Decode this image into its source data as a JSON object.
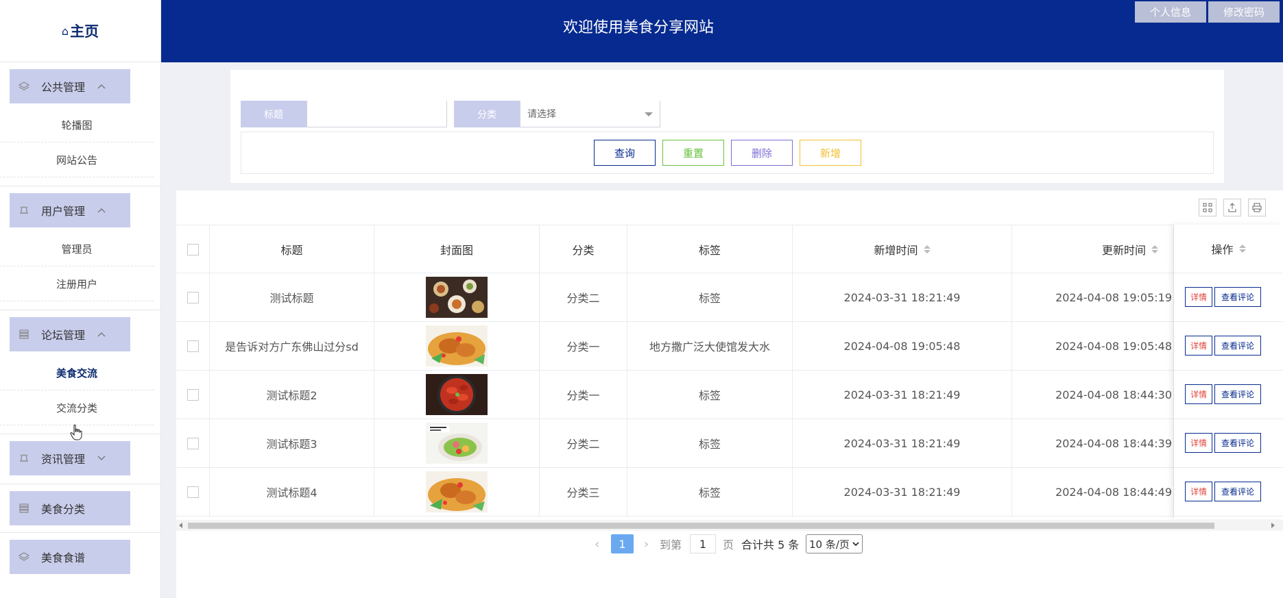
{
  "sidebar": {
    "home_label": "主页",
    "groups": [
      {
        "label": "公共管理",
        "items": [
          "轮播图",
          "网站公告"
        ]
      },
      {
        "label": "用户管理",
        "items": [
          "管理员",
          "注册用户"
        ]
      },
      {
        "label": "论坛管理",
        "items": [
          "美食交流",
          "交流分类"
        ]
      },
      {
        "label": "资讯管理",
        "items": []
      },
      {
        "label": "美食分类",
        "items": []
      },
      {
        "label": "美食食谱",
        "items": []
      }
    ],
    "active_item": "美食交流"
  },
  "header": {
    "title": "欢迎使用美食分享网站",
    "profile_button": "个人信息",
    "password_button": "修改密码"
  },
  "search": {
    "title_label": "标题",
    "title_value": "",
    "category_label": "分类",
    "category_placeholder": "请选择",
    "buttons": {
      "query": "查询",
      "reset": "重置",
      "delete": "删除",
      "add": "新增"
    }
  },
  "colors": {
    "primary": "#062a8f",
    "accent_light": "#c9cdec",
    "reset_green": "#67c23a",
    "delete_purple": "#7b6fd6",
    "add_yellow": "#f0c030",
    "detail_red": "#e0443b",
    "page_active": "#6aa9f0"
  },
  "table": {
    "columns": [
      "标题",
      "封面图",
      "分类",
      "标签",
      "新增时间",
      "更新时间",
      "操作"
    ],
    "rows": [
      {
        "title": "测试标题",
        "category": "分类二",
        "tag": "标签",
        "created": "2024-03-31 18:21:49",
        "updated": "2024-04-08 19:05:19"
      },
      {
        "title": "是告诉对方广东佛山过分sd",
        "category": "分类一",
        "tag": "地方撒广泛大使馆发大水",
        "created": "2024-04-08 19:05:48",
        "updated": "2024-04-08 19:05:48"
      },
      {
        "title": "测试标题2",
        "category": "分类一",
        "tag": "标签",
        "created": "2024-03-31 18:21:49",
        "updated": "2024-04-08 18:44:30"
      },
      {
        "title": "测试标题3",
        "category": "分类二",
        "tag": "标签",
        "created": "2024-03-31 18:21:49",
        "updated": "2024-04-08 18:44:39"
      },
      {
        "title": "测试标题4",
        "category": "分类三",
        "tag": "标签",
        "created": "2024-03-31 18:21:49",
        "updated": "2024-04-08 18:44:49"
      }
    ],
    "action_detail": "详情",
    "action_comments": "查看评论"
  },
  "pager": {
    "current_page": "1",
    "goto_label": "到第",
    "goto_value": "1",
    "page_suffix": "页",
    "total_text": "合计共 5 条",
    "page_size": "10 条/页"
  }
}
